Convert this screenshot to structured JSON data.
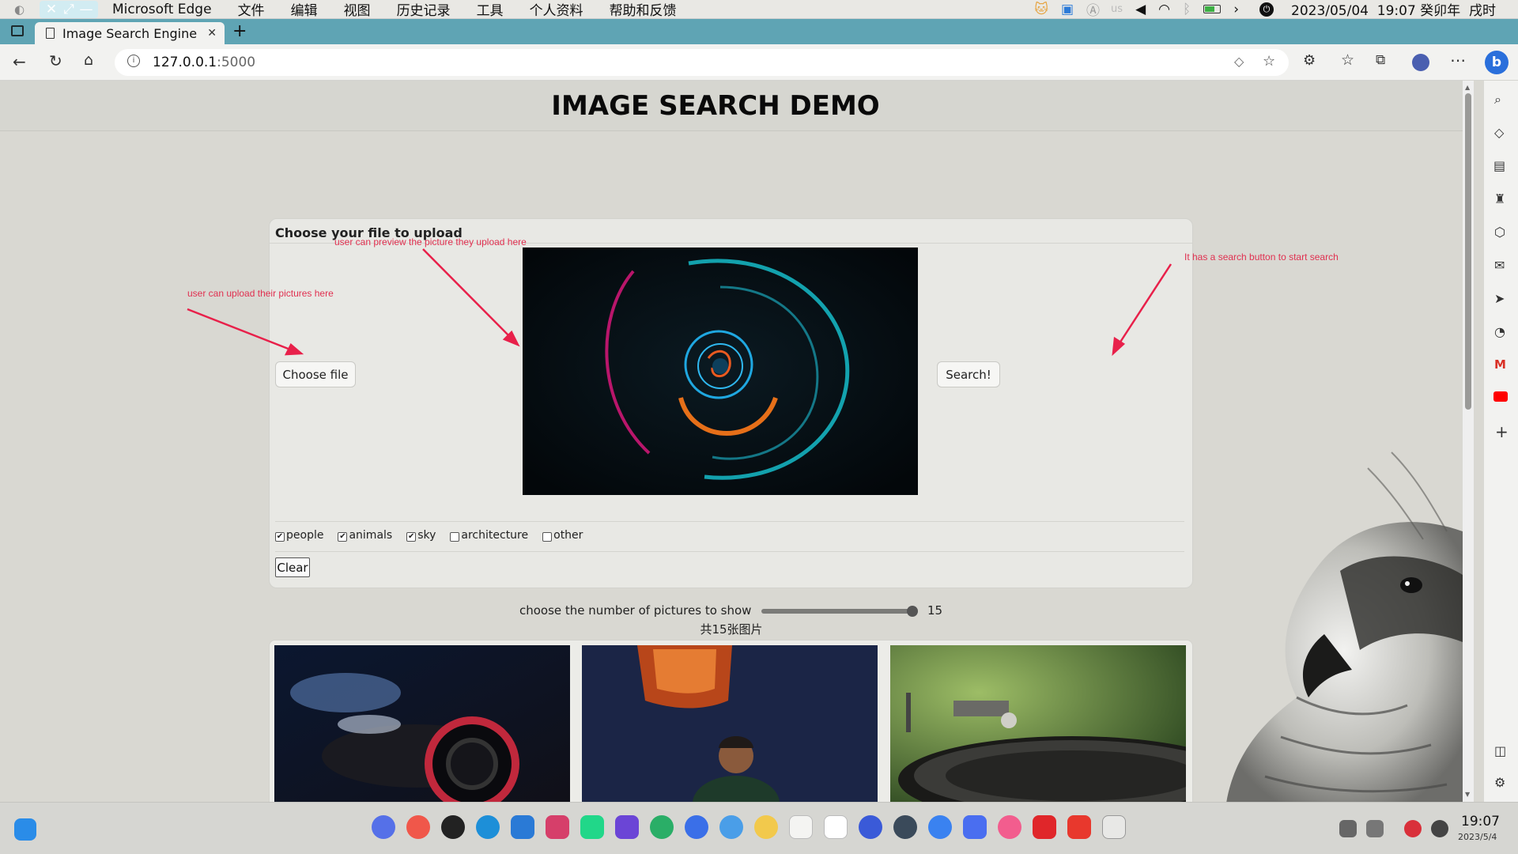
{
  "os_menubar": {
    "app": "Microsoft Edge",
    "menus": [
      "文件",
      "编辑",
      "视图",
      "历史记录",
      "工具",
      "个人资料",
      "帮助和反馈"
    ],
    "input_method": "us",
    "datetime": "2023/05/04  19:07 癸卯年  戌时"
  },
  "browser": {
    "tab_title": "Image Search Engine",
    "url_host": "127.0.0.1",
    "url_port": ":5000"
  },
  "page": {
    "heading": "IMAGE SEARCH DEMO",
    "upload_title": "Choose your file to upload",
    "choose_file_label": "Choose file",
    "search_label": "Search!",
    "annotations": {
      "upload": "user can upload their pictures here",
      "preview": "user can preview the picture they upload here",
      "search": "It has a search button to start search"
    },
    "categories": [
      {
        "label": "people",
        "checked": true
      },
      {
        "label": "animals",
        "checked": true
      },
      {
        "label": "sky",
        "checked": true
      },
      {
        "label": "architecture",
        "checked": false
      },
      {
        "label": "other",
        "checked": false
      }
    ],
    "clear_label": "Clear",
    "slider_label": "choose the number of pictures to show",
    "slider_value": "15",
    "slider_fraction": 1.0,
    "result_count": "共15张图片"
  },
  "taskbar": {
    "time": "19:07",
    "date": "2023/5/4"
  },
  "colors": {
    "tab_strip": "#5fa4b4",
    "annotation": "#e03050",
    "page_bg": "#d9d8d2"
  }
}
